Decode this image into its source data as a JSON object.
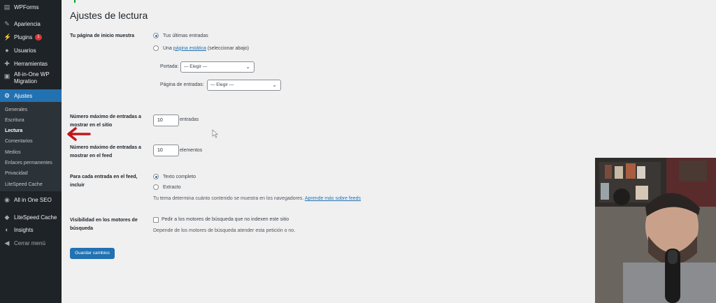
{
  "sidebar": {
    "items": [
      {
        "label": "WPForms",
        "icon": "wpforms-icon"
      },
      {
        "label": "Apariencia",
        "icon": "brush-icon"
      },
      {
        "label": "Plugins",
        "icon": "plugin-icon",
        "badge": "1"
      },
      {
        "label": "Usuarios",
        "icon": "users-icon"
      },
      {
        "label": "Herramientas",
        "icon": "wrench-icon"
      },
      {
        "label": "All-in-One WP Migration",
        "icon": "migration-icon"
      },
      {
        "label": "Ajustes",
        "icon": "settings-icon"
      }
    ],
    "submenu": [
      "Generales",
      "Escritura",
      "Lectura",
      "Comentarios",
      "Medios",
      "Enlaces permanentes",
      "Privacidad",
      "LiteSpeed Cache"
    ],
    "bottom_items": [
      {
        "label": "All in One SEO",
        "icon": "seo-icon"
      },
      {
        "label": "LiteSpeed Cache",
        "icon": "litespeed-icon"
      },
      {
        "label": "Insights",
        "icon": "insights-icon"
      },
      {
        "label": "Cerrar menú",
        "icon": "collapse-icon"
      }
    ]
  },
  "main": {
    "title": "Ajustes de lectura",
    "homepage": {
      "label": "Tu página de inicio muestra",
      "option_latest": "Tus últimas entradas",
      "option_static_prefix": "Una",
      "option_static_link": "página estática",
      "option_static_suffix": "(seleccionar abajo)",
      "portada_label": "Portada:",
      "portada_value": "— Elegir —",
      "entradas_label": "Página de entradas:",
      "entradas_value": "— Elegir —"
    },
    "posts_per_page": {
      "label": "Número máximo de entradas a mostrar en el sitio",
      "value": "10",
      "unit": "entradas"
    },
    "posts_per_feed": {
      "label": "Número máximo de entradas a mostrar en el feed",
      "value": "10",
      "unit": "elementos"
    },
    "feed_content": {
      "label": "Para cada entrada en el feed, incluir",
      "option_full": "Texto completo",
      "option_excerpt": "Extracto",
      "desc_text": "Tu tema determina cuánto contenido se muestra en los navegadores.",
      "desc_link": "Aprende más sobre feeds"
    },
    "search_visibility": {
      "label": "Visibilidad en los motores de búsqueda",
      "checkbox_label": "Pedir a los motores de búsqueda que no indexen este sitio",
      "desc": "Depende de los motores de búsqueda atender esta petición o no."
    },
    "save_button": "Guardar cambios"
  },
  "colors": {
    "sidebar_bg": "#1d2327",
    "accent": "#2271b1",
    "arrow": "#c0161b"
  }
}
